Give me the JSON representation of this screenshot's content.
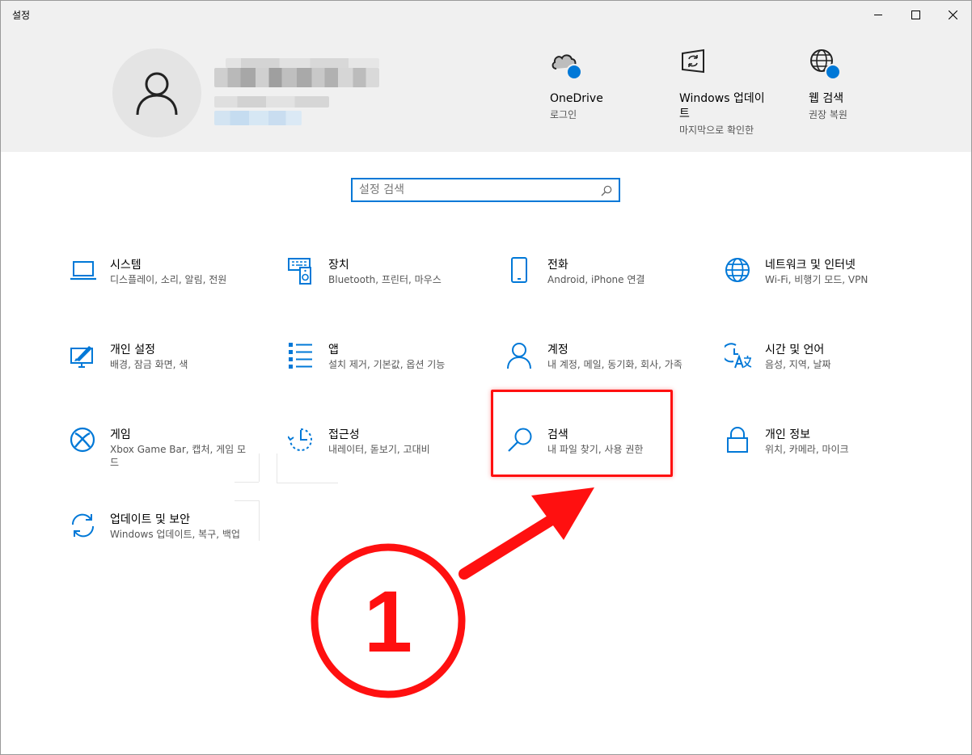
{
  "window": {
    "title": "설정"
  },
  "account": {
    "avatar_icon": "person-icon"
  },
  "quick_links": [
    {
      "title": "OneDrive",
      "subtitle": "로그인",
      "icon": "cloud-icon"
    },
    {
      "title": "Windows 업데이트",
      "subtitle": "마지막으로 확인한",
      "icon": "update-icon"
    },
    {
      "title": "웹 검색",
      "subtitle": "권장 복원",
      "icon": "globe-icon"
    }
  ],
  "search": {
    "placeholder": "설정 검색"
  },
  "tiles": [
    {
      "title": "시스템",
      "subtitle": "디스플레이, 소리, 알림, 전원",
      "icon": "laptop-icon"
    },
    {
      "title": "장치",
      "subtitle": "Bluetooth, 프린터, 마우스",
      "icon": "devices-icon"
    },
    {
      "title": "전화",
      "subtitle": "Android, iPhone 연결",
      "icon": "phone-icon"
    },
    {
      "title": "네트워크 및 인터넷",
      "subtitle": "Wi-Fi, 비행기 모드, VPN",
      "icon": "globe-icon"
    },
    {
      "title": "개인 설정",
      "subtitle": "배경, 잠금 화면, 색",
      "icon": "personalization-icon"
    },
    {
      "title": "앱",
      "subtitle": "설치 제거, 기본값, 옵션 기능",
      "icon": "apps-list-icon"
    },
    {
      "title": "계정",
      "subtitle": "내 계정, 메일, 동기화, 회사, 가족",
      "icon": "account-icon"
    },
    {
      "title": "시간 및 언어",
      "subtitle": "음성, 지역, 날짜",
      "icon": "time-language-icon"
    },
    {
      "title": "게임",
      "subtitle": "Xbox Game Bar, 캡처, 게임 모드",
      "icon": "xbox-icon"
    },
    {
      "title": "접근성",
      "subtitle": "내레이터, 돋보기, 고대비",
      "icon": "accessibility-icon"
    },
    {
      "title": "검색",
      "subtitle": "내 파일 찾기, 사용 권한",
      "icon": "search-icon"
    },
    {
      "title": "개인 정보",
      "subtitle": "위치, 카메라, 마이크",
      "icon": "lock-icon"
    },
    {
      "title": "업데이트 및 보안",
      "subtitle": "Windows 업데이트, 복구, 백업",
      "icon": "sync-icon"
    }
  ],
  "annotation": {
    "step_number": "1",
    "color": "#ff1010"
  },
  "colors": {
    "accent": "#0078d7",
    "header_bg": "#f0f0f0"
  }
}
